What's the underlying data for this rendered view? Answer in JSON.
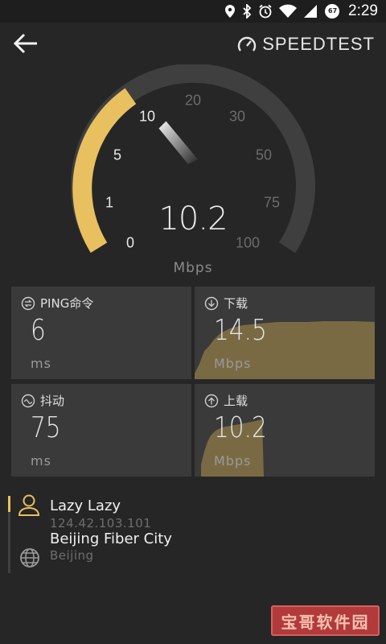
{
  "status_bar": {
    "time": "2:29",
    "battery_level": "67",
    "icons": [
      "location-icon",
      "bluetooth-icon",
      "alarm-icon",
      "wifi-icon",
      "signal-icon",
      "battery-icon"
    ]
  },
  "header": {
    "back_icon": "back-arrow-icon",
    "brand": "SPEEDTEST"
  },
  "gauge": {
    "labels": [
      "0",
      "1",
      "5",
      "10",
      "20",
      "30",
      "50",
      "75",
      "100"
    ],
    "value": "10.2",
    "unit": "Mbps",
    "accent_color": "#e8c05f",
    "track_color": "#3f3f3f"
  },
  "cards": {
    "ping": {
      "title": "PING命令",
      "value": "6",
      "unit": "ms",
      "icon": "ping-icon"
    },
    "download": {
      "title": "下载",
      "value": "14.5",
      "unit": "Mbps",
      "icon": "download-icon"
    },
    "jitter": {
      "title": "抖动",
      "value": "75",
      "unit": "ms",
      "icon": "jitter-icon"
    },
    "upload": {
      "title": "上载",
      "value": "10.2",
      "unit": "Mbps",
      "icon": "upload-icon"
    },
    "area_color": "#7a6a44"
  },
  "server": {
    "user_name": "Lazy Lazy",
    "user_ip": "124.42.103.101",
    "host_name": "Beijing Fiber City",
    "host_city": "Beijing"
  },
  "watermark": "宝哥软件园"
}
